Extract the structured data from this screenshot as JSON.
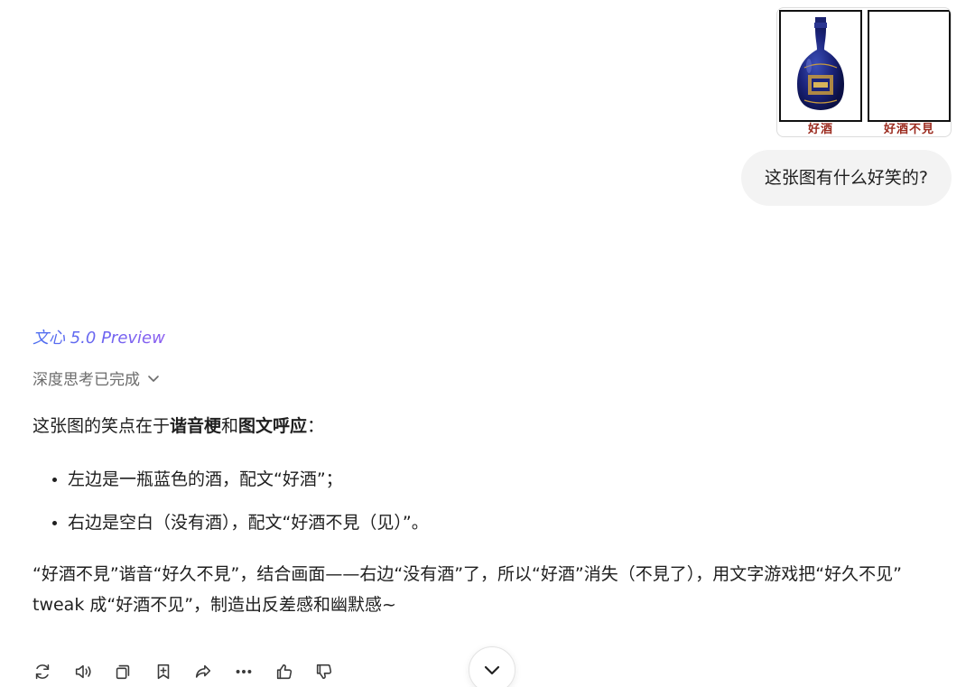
{
  "attachment": {
    "left_caption": "好酒",
    "right_caption": "好酒不見"
  },
  "user_message": "这张图有什么好笑的?",
  "model": {
    "name": "文心 5.0 Preview"
  },
  "thinking": {
    "label": "深度思考已完成"
  },
  "answer": {
    "intro_prefix": "这张图的笑点在于",
    "intro_bold1": "谐音梗",
    "intro_mid": "和",
    "intro_bold2": "图文呼应",
    "intro_suffix": "：",
    "bullets": [
      "左边是一瓶蓝色的酒，配文“好酒”；",
      "右边是空白（没有酒），配文“好酒不見（见）”。"
    ],
    "conclusion": "“好酒不見”谐音“好久不見”，结合画面——右边“没有酒”了，所以“好酒”消失（不見了），用文字游戏把“好久不见” tweak 成“好酒不见”，制造出反差感和幽默感~"
  },
  "actions": [
    {
      "name": "regenerate-icon"
    },
    {
      "name": "speaker-icon"
    },
    {
      "name": "copy-icon"
    },
    {
      "name": "bookmark-add-icon"
    },
    {
      "name": "share-icon"
    },
    {
      "name": "more-icon"
    },
    {
      "name": "thumbs-up-icon"
    },
    {
      "name": "thumbs-down-icon"
    }
  ],
  "colors": {
    "accent": "#5b6cf0",
    "bubble_bg": "#f3f3f3",
    "caption_red": "#9b2a1e"
  }
}
